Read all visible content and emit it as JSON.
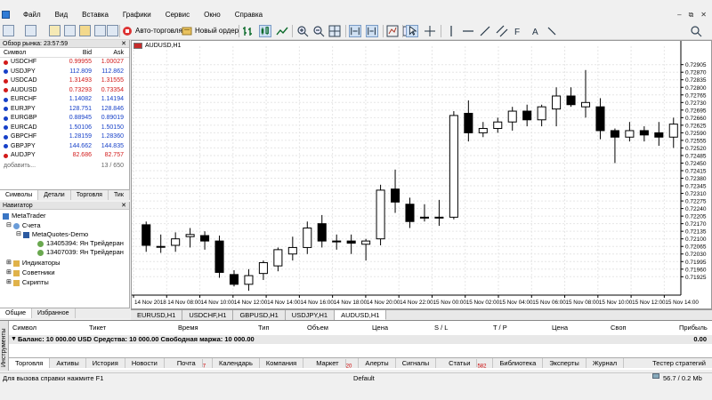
{
  "menu": [
    "Файл",
    "Вид",
    "Вставка",
    "Графики",
    "Сервис",
    "Окно",
    "Справка"
  ],
  "toolbar": {
    "auto_trading": "Авто-торговля",
    "new_order": "Новый ордер"
  },
  "market_watch": {
    "title": "Обзор рынка: 23:57:59",
    "col_symbol": "Символ",
    "col_bid": "Bid",
    "col_ask": "Ask",
    "rows": [
      {
        "symbol": "USDCHF",
        "bid": "0.99955",
        "ask": "1.00027",
        "dir": "dn"
      },
      {
        "symbol": "USDJPY",
        "bid": "112.809",
        "ask": "112.862",
        "dir": "up"
      },
      {
        "symbol": "USDCAD",
        "bid": "1.31493",
        "ask": "1.31555",
        "dir": "dn"
      },
      {
        "symbol": "AUDUSD",
        "bid": "0.73293",
        "ask": "0.73354",
        "dir": "dn"
      },
      {
        "symbol": "EURCHF",
        "bid": "1.14082",
        "ask": "1.14194",
        "dir": "up"
      },
      {
        "symbol": "EURJPY",
        "bid": "128.751",
        "ask": "128.846",
        "dir": "up"
      },
      {
        "symbol": "EURGBP",
        "bid": "0.88945",
        "ask": "0.89019",
        "dir": "up"
      },
      {
        "symbol": "EURCAD",
        "bid": "1.50106",
        "ask": "1.50150",
        "dir": "up"
      },
      {
        "symbol": "GBPCHF",
        "bid": "1.28159",
        "ask": "1.28360",
        "dir": "up"
      },
      {
        "symbol": "GBPJPY",
        "bid": "144.662",
        "ask": "144.835",
        "dir": "up"
      },
      {
        "symbol": "AUDJPY",
        "bid": "82.686",
        "ask": "82.757",
        "dir": "dn"
      }
    ],
    "add_label": "добавить...",
    "count": "13 / 650",
    "tabs": [
      "Символы",
      "Детали",
      "Торговля",
      "Тик"
    ]
  },
  "navigator": {
    "title": "Навигатор",
    "root": "MetaTrader",
    "accounts": "Счета",
    "server": "MetaQuotes-Demo",
    "acc1": "13405394: Ян Трейдеран",
    "acc2": "13407039: Ян Трейдеран",
    "indicators": "Индикаторы",
    "advisors": "Советники",
    "scripts": "Скрипты",
    "tabs": [
      "Общие",
      "Избранное"
    ]
  },
  "chart_label": "AUDUSD,H1",
  "chart_tabs": [
    "EURUSD,H1",
    "USDCHF,H1",
    "GBPUSD,H1",
    "USDJPY,H1",
    "AUDUSD,H1"
  ],
  "chart_data": {
    "type": "candlestick",
    "symbol": "AUDUSD",
    "timeframe": "H1",
    "ylim": [
      0.7184,
      0.7299
    ],
    "y_ticks": [
      "0.72905",
      "0.72870",
      "0.72835",
      "0.72800",
      "0.72765",
      "0.72730",
      "0.72695",
      "0.72660",
      "0.72625",
      "0.72590",
      "0.72555",
      "0.72520",
      "0.72485",
      "0.72450",
      "0.72415",
      "0.72380",
      "0.72345",
      "0.72310",
      "0.72275",
      "0.72240",
      "0.72205",
      "0.72170",
      "0.72135",
      "0.72100",
      "0.72065",
      "0.72030",
      "0.71995",
      "0.71960",
      "0.71925"
    ],
    "x_ticks": [
      "14 Nov 2018",
      "14 Nov 08:00",
      "14 Nov 10:00",
      "14 Nov 12:00",
      "14 Nov 14:00",
      "14 Nov 16:00",
      "14 Nov 18:00",
      "14 Nov 20:00",
      "14 Nov 22:00",
      "15 Nov 00:00",
      "15 Nov 02:00",
      "15 Nov 04:00",
      "15 Nov 06:00",
      "15 Nov 08:00",
      "15 Nov 10:00",
      "15 Nov 12:00",
      "15 Nov 14:00"
    ],
    "candles": [
      {
        "o": 0.72165,
        "h": 0.7218,
        "l": 0.7204,
        "c": 0.7207
      },
      {
        "o": 0.72065,
        "h": 0.7212,
        "l": 0.72035,
        "c": 0.72065
      },
      {
        "o": 0.7207,
        "h": 0.7213,
        "l": 0.7204,
        "c": 0.721
      },
      {
        "o": 0.7211,
        "h": 0.7215,
        "l": 0.7206,
        "c": 0.7212
      },
      {
        "o": 0.72115,
        "h": 0.72135,
        "l": 0.7205,
        "c": 0.7209
      },
      {
        "o": 0.7209,
        "h": 0.72115,
        "l": 0.7192,
        "c": 0.71945
      },
      {
        "o": 0.71935,
        "h": 0.71955,
        "l": 0.7188,
        "c": 0.7189
      },
      {
        "o": 0.7189,
        "h": 0.7196,
        "l": 0.7186,
        "c": 0.7193
      },
      {
        "o": 0.7194,
        "h": 0.72,
        "l": 0.7191,
        "c": 0.7199
      },
      {
        "o": 0.71975,
        "h": 0.7206,
        "l": 0.7195,
        "c": 0.7205
      },
      {
        "o": 0.7203,
        "h": 0.7211,
        "l": 0.72,
        "c": 0.7206
      },
      {
        "o": 0.7206,
        "h": 0.7218,
        "l": 0.7203,
        "c": 0.7215
      },
      {
        "o": 0.7217,
        "h": 0.7221,
        "l": 0.7206,
        "c": 0.7209
      },
      {
        "o": 0.7209,
        "h": 0.7212,
        "l": 0.7205,
        "c": 0.7209
      },
      {
        "o": 0.7209,
        "h": 0.7212,
        "l": 0.7203,
        "c": 0.7208
      },
      {
        "o": 0.72075,
        "h": 0.721,
        "l": 0.72,
        "c": 0.7209
      },
      {
        "o": 0.721,
        "h": 0.7235,
        "l": 0.7207,
        "c": 0.72325
      },
      {
        "o": 0.7233,
        "h": 0.7242,
        "l": 0.7222,
        "c": 0.7227
      },
      {
        "o": 0.7226,
        "h": 0.7229,
        "l": 0.7215,
        "c": 0.7218
      },
      {
        "o": 0.722,
        "h": 0.7226,
        "l": 0.7218,
        "c": 0.722
      },
      {
        "o": 0.722,
        "h": 0.7228,
        "l": 0.7216,
        "c": 0.722
      },
      {
        "o": 0.722,
        "h": 0.7269,
        "l": 0.7219,
        "c": 0.7267
      },
      {
        "o": 0.7268,
        "h": 0.7274,
        "l": 0.7255,
        "c": 0.7259
      },
      {
        "o": 0.7259,
        "h": 0.7264,
        "l": 0.7257,
        "c": 0.7261
      },
      {
        "o": 0.7261,
        "h": 0.7266,
        "l": 0.7259,
        "c": 0.7264
      },
      {
        "o": 0.7264,
        "h": 0.7271,
        "l": 0.726,
        "c": 0.7269
      },
      {
        "o": 0.7269,
        "h": 0.7272,
        "l": 0.7262,
        "c": 0.7265
      },
      {
        "o": 0.7265,
        "h": 0.7272,
        "l": 0.7262,
        "c": 0.7271
      },
      {
        "o": 0.727,
        "h": 0.728,
        "l": 0.7262,
        "c": 0.7276
      },
      {
        "o": 0.7276,
        "h": 0.728,
        "l": 0.7271,
        "c": 0.7272
      },
      {
        "o": 0.7271,
        "h": 0.7288,
        "l": 0.7266,
        "c": 0.7273
      },
      {
        "o": 0.7271,
        "h": 0.7275,
        "l": 0.7256,
        "c": 0.726
      },
      {
        "o": 0.726,
        "h": 0.7261,
        "l": 0.7245,
        "c": 0.7257
      },
      {
        "o": 0.7257,
        "h": 0.7264,
        "l": 0.7255,
        "c": 0.726
      },
      {
        "o": 0.726,
        "h": 0.7262,
        "l": 0.7255,
        "c": 0.7258
      },
      {
        "o": 0.7259,
        "h": 0.7264,
        "l": 0.7253,
        "c": 0.7257
      },
      {
        "o": 0.7257,
        "h": 0.7266,
        "l": 0.7252,
        "c": 0.7263
      }
    ]
  },
  "terminal": {
    "vertical_label": "Инструменты",
    "columns": [
      "Символ",
      "Тикет",
      "Время",
      "Тип",
      "Объем",
      "Цена",
      "S / L",
      "T / P",
      "Цена",
      "Своп",
      "Прибыль"
    ],
    "balance_row": "Баланс: 10 000.00 USD  Средства: 10 000.00  Свободная маржа: 10 000.00",
    "balance_value": "0.00",
    "tabs": [
      "Торговля",
      "Активы",
      "История",
      "Новости",
      "Почта",
      "Календарь",
      "Компания",
      "Маркет",
      "Алерты",
      "Сигналы",
      "Статьи",
      "Библиотека",
      "Эксперты",
      "Журнал"
    ],
    "mail_badge": "7",
    "market_badge": "20",
    "articles_badge": "582",
    "tester": "Тестер стратегий"
  },
  "status": {
    "help": "Для вызова справки нажмите F1",
    "profile": "Default",
    "traffic": "56.7 / 0.2 Mb"
  },
  "colors": {
    "up_price": "#1640c8",
    "down_price": "#d21a1a",
    "grid": "#e6e6e6"
  }
}
